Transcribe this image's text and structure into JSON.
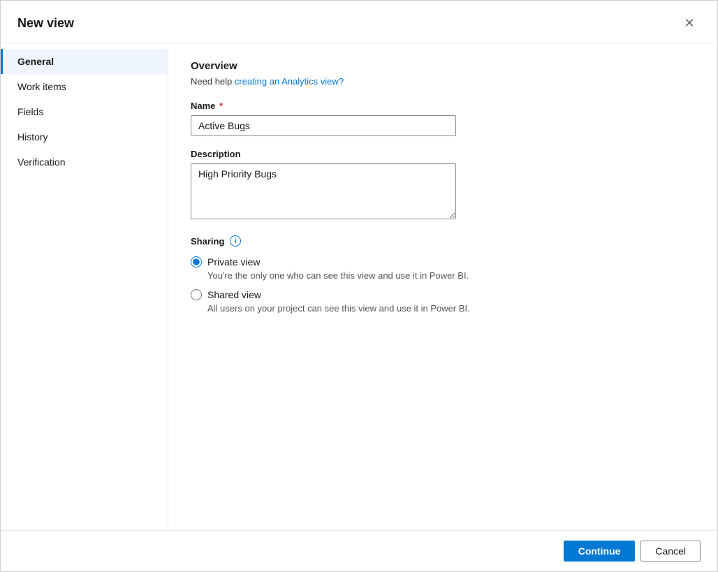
{
  "dialog": {
    "title": "New view",
    "close_label": "×"
  },
  "sidebar": {
    "items": [
      {
        "id": "general",
        "label": "General",
        "active": true
      },
      {
        "id": "work-items",
        "label": "Work items",
        "active": false
      },
      {
        "id": "fields",
        "label": "Fields",
        "active": false
      },
      {
        "id": "history",
        "label": "History",
        "active": false
      },
      {
        "id": "verification",
        "label": "Verification",
        "active": false
      }
    ]
  },
  "main": {
    "overview_title": "Overview",
    "help_text_prefix": "Need help ",
    "help_link_text": "creating an Analytics view?",
    "name_label": "Name",
    "name_value": "Active Bugs",
    "description_label": "Description",
    "description_value": "High Priority Bugs",
    "sharing_label": "Sharing",
    "info_icon_label": "i",
    "sharing_options": [
      {
        "id": "private",
        "label": "Private view",
        "description": "You're the only one who can see this view and use it in Power BI.",
        "checked": true
      },
      {
        "id": "shared",
        "label": "Shared view",
        "description": "All users on your project can see this view and use it in Power BI.",
        "checked": false
      }
    ]
  },
  "footer": {
    "continue_label": "Continue",
    "cancel_label": "Cancel"
  }
}
